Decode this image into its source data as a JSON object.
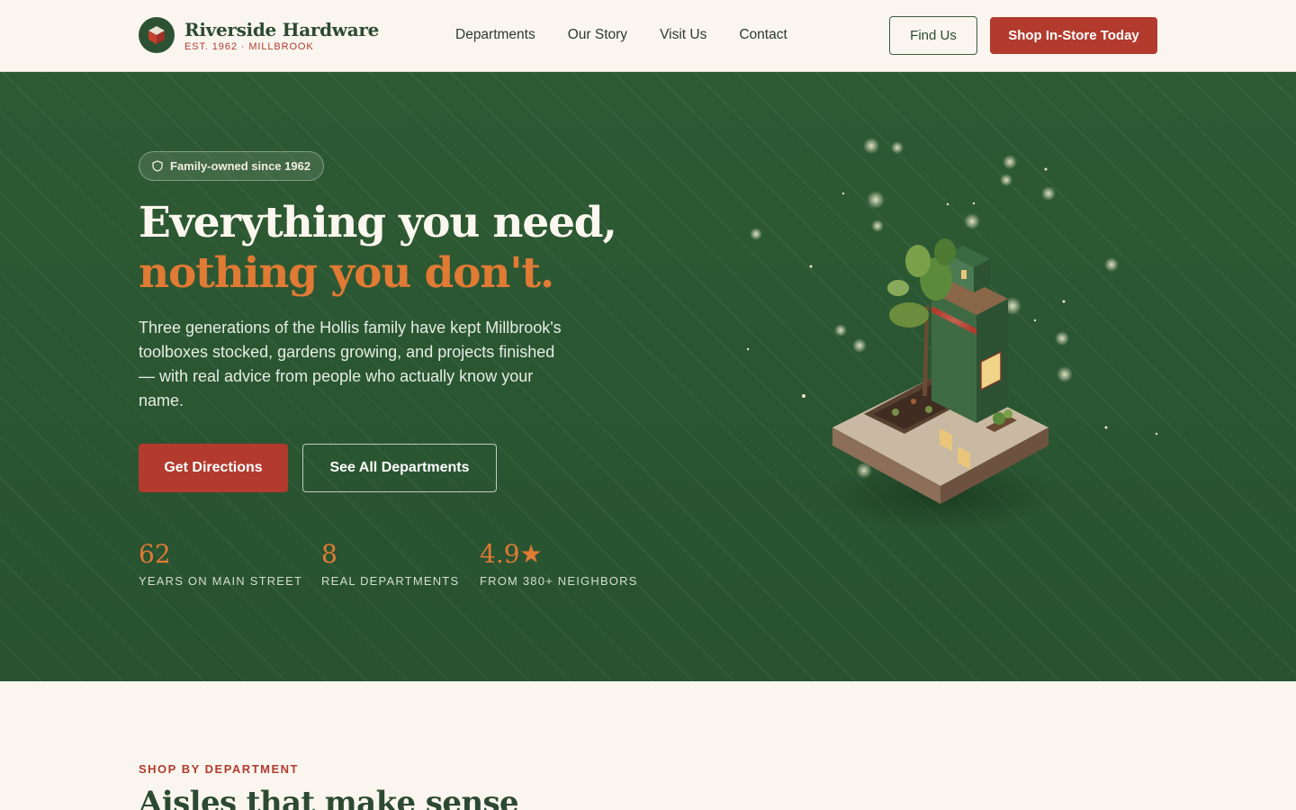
{
  "colors": {
    "brand_green": "#2c5233",
    "accent_red": "#b23b2e",
    "accent_orange": "#e07a34",
    "cream": "#faf6ef"
  },
  "header": {
    "brand_name": "Riverside Hardware",
    "brand_sub": "EST. 1962 · MILLBROOK",
    "logo_icon": "cube-icon",
    "nav": [
      "Departments",
      "Our Story",
      "Visit Us",
      "Contact"
    ],
    "find_label": "Find Us",
    "shop_label": "Shop In-Store Today"
  },
  "hero": {
    "badge_icon": "shield-icon",
    "badge": "Family-owned since 1962",
    "headline_1": "Everything you need,",
    "headline_2": "nothing you don't.",
    "lead": "Three generations of the Hollis family have kept Millbrook's toolboxes stocked, gardens growing, and projects finished — with real advice from people who actually know your name.",
    "cta_primary": "Get Directions",
    "cta_secondary": "See All Departments",
    "stats": [
      {
        "value": "62",
        "label": "YEARS ON MAIN STREET"
      },
      {
        "value": "8",
        "label": "REAL DEPARTMENTS"
      },
      {
        "value": "4.9★",
        "label": "FROM 380+ NEIGHBORS"
      }
    ]
  },
  "departments_section": {
    "eyebrow": "SHOP BY DEPARTMENT",
    "title": "Aisles that make sense"
  }
}
